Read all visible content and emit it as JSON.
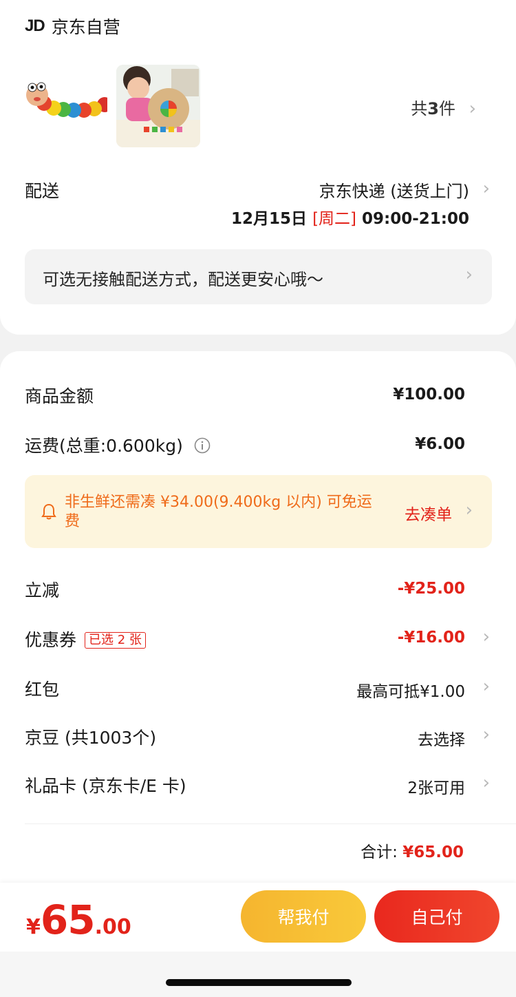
{
  "shop": {
    "logo": "JD",
    "name": "京东自营"
  },
  "items": {
    "images": [
      "wooden-caterpillar-toy",
      "child-playing-wooden-clock"
    ],
    "count_prefix": "共",
    "count": "3",
    "count_suffix": "件"
  },
  "delivery": {
    "label": "配送",
    "method": "京东快递 (送货上门)",
    "date": "12月15日",
    "weekday": "[周二]",
    "time": "09:00-21:00",
    "notice": "可选无接触配送方式，配送更安心哦～"
  },
  "summary": {
    "goods_label": "商品金额",
    "goods_value": "¥100.00",
    "shipping_label": "运费(总重:0.600kg)",
    "shipping_value": "¥6.00",
    "promo_text": "非生鲜还需凑 ¥34.00(9.400kg 以内) 可免运费",
    "promo_link": "去凑单",
    "discount_label": "立减",
    "discount_value": "-¥25.00",
    "coupon_label": "优惠券",
    "coupon_badge": "已选 2 张",
    "coupon_value": "-¥16.00",
    "redpacket_label": "红包",
    "redpacket_value": "最高可抵¥1.00",
    "jingdou_label": "京豆 (共1003个)",
    "jingdou_value": "去选择",
    "giftcard_label": "礼品卡 (京东卡/E 卡)",
    "giftcard_value": "2张可用",
    "total_label": "合计:",
    "total_value": "¥65.00"
  },
  "pay": {
    "currency": "¥",
    "integer": "65",
    "decimal": ".00",
    "help_pay": "帮我付",
    "self_pay": "自己付"
  },
  "colors": {
    "accent_red": "#e2231a",
    "promo_orange": "#ef6b1a",
    "help_yellow": "#f7bd33"
  }
}
